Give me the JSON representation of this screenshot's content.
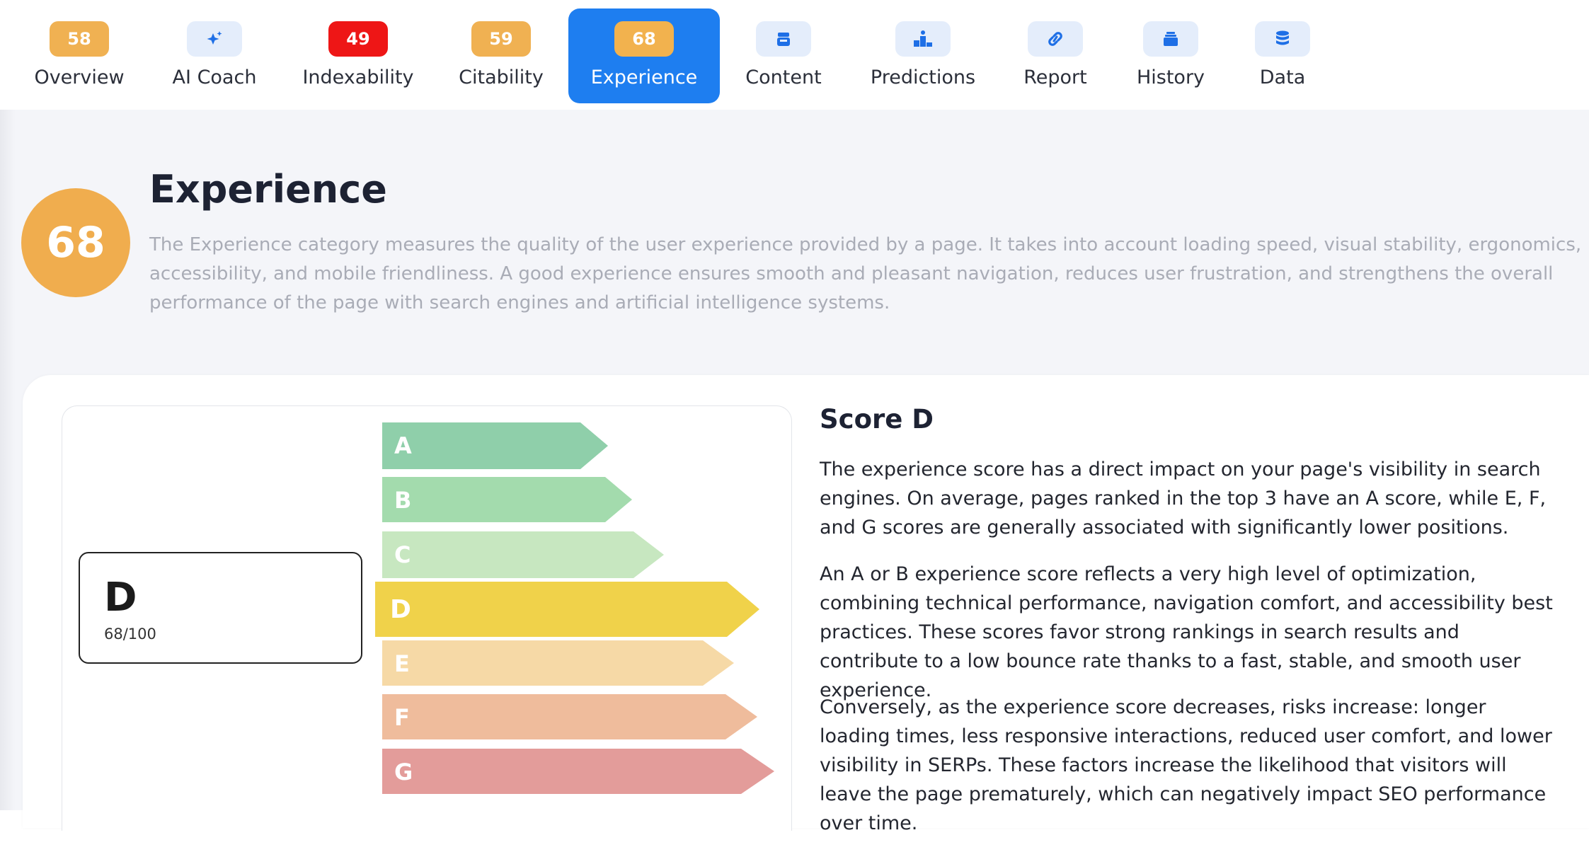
{
  "nav": {
    "tabs": [
      {
        "label": "Overview",
        "badge": "58",
        "badge_type": "score",
        "badge_color": "#f0b152",
        "active": false
      },
      {
        "label": "AI Coach",
        "icon": "sparkle-icon",
        "badge_type": "icon",
        "active": false
      },
      {
        "label": "Indexability",
        "badge": "49",
        "badge_type": "score",
        "badge_color": "#ee1616",
        "active": false
      },
      {
        "label": "Citability",
        "badge": "59",
        "badge_type": "score",
        "badge_color": "#f0b152",
        "active": false
      },
      {
        "label": "Experience",
        "badge": "68",
        "badge_type": "score",
        "badge_color": "#f2b24e",
        "active": true
      },
      {
        "label": "Content",
        "icon": "basket-icon",
        "badge_type": "icon",
        "active": false
      },
      {
        "label": "Predictions",
        "icon": "podium-icon",
        "badge_type": "icon",
        "active": false
      },
      {
        "label": "Report",
        "icon": "link-icon",
        "badge_type": "icon",
        "active": false
      },
      {
        "label": "History",
        "icon": "stack-icon",
        "badge_type": "icon",
        "active": false
      },
      {
        "label": "Data",
        "icon": "database-icon",
        "badge_type": "icon",
        "active": false
      }
    ]
  },
  "category": {
    "score": "68",
    "title": "Experience",
    "description": "The Experience category measures the quality of the user experience provided by a page. It takes into account loading speed, visual stability, ergonomics, accessibility, and mobile friendliness. A good experience ensures smooth and pleasant navigation, reduces user frustration, and strengthens the overall performance of the page with search engines and artificial intelligence systems."
  },
  "grade": {
    "letter": "D",
    "score_text": "68/100",
    "scale": [
      {
        "letter": "A",
        "color": "#8fcfaa"
      },
      {
        "letter": "B",
        "color": "#a3dbad"
      },
      {
        "letter": "C",
        "color": "#c7e7c0"
      },
      {
        "letter": "D",
        "color": "#f0d24a",
        "current": true
      },
      {
        "letter": "E",
        "color": "#f6d9a6"
      },
      {
        "letter": "F",
        "color": "#efbc9c"
      },
      {
        "letter": "G",
        "color": "#e39c9a"
      }
    ]
  },
  "explanation": {
    "heading": "Score D",
    "paragraphs": [
      "The experience score has a direct impact on your page's visibility in search engines. On average, pages ranked in the top 3 have an A score, while E, F, and G scores are generally associated with significantly lower positions.",
      "An A or B experience score reflects a very high level of optimization, combining technical performance, navigation comfort, and accessibility best practices. These scores favor strong rankings in search results and contribute to a low bounce rate thanks to a fast, stable, and smooth user experience.",
      "Conversely, as the experience score decreases, risks increase: longer loading times, less responsive interactions, reduced user comfort, and lower visibility in SERPs. These factors increase the likelihood that visitors will leave the page prematurely, which can negatively impact SEO performance over time."
    ]
  }
}
